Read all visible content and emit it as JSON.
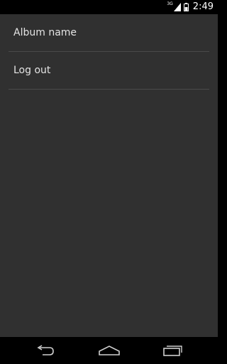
{
  "status_bar": {
    "network": "3G",
    "time": "2:49",
    "icons": [
      "signal-icon",
      "battery-icon"
    ]
  },
  "settings_list": {
    "items": [
      {
        "label": "Album name"
      },
      {
        "label": "Log out"
      }
    ]
  },
  "nav_bar": {
    "icons": [
      "back-icon",
      "home-icon",
      "recent-apps-icon"
    ]
  },
  "colors": {
    "background": "#303030",
    "text": "#e4e4e4",
    "divider": "#4a4a4a",
    "bars": "#000000"
  }
}
